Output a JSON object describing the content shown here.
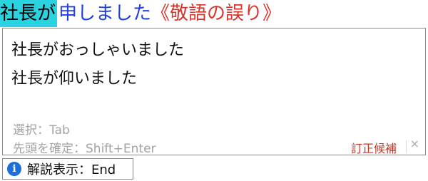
{
  "composition": {
    "active_segment": "社長が",
    "rest_segment": "申しました",
    "note": "《敬語の誤り》"
  },
  "candidates": [
    {
      "text": "社長がおっしゃいました"
    },
    {
      "text": "社長が仰いました"
    }
  ],
  "hints": {
    "select": "選択：Tab",
    "confirm_head": "先頭を確定：Shift+Enter"
  },
  "footer": {
    "correction_label": "訂正候補",
    "close_glyph": "×"
  },
  "explain_toggle": {
    "icon_glyph": "i",
    "label": "解説表示：End"
  },
  "colors": {
    "active_bg": "#29d3df",
    "rest_text": "#1f3fe0",
    "note_text": "#d9342b",
    "correction_label": "#c0392b",
    "info_icon_bg": "#1e6fd9"
  }
}
